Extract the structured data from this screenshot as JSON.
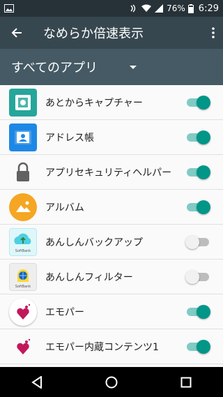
{
  "status_bar": {
    "battery": "76%",
    "time": "6:29"
  },
  "toolbar": {
    "title": "なめらか倍速表示"
  },
  "filter": {
    "label": "すべてのアプリ"
  },
  "apps": [
    {
      "name": "あとからキャプチャー",
      "enabled": true,
      "icon": "capture-icon"
    },
    {
      "name": "アドレス帳",
      "enabled": true,
      "icon": "address-book-icon"
    },
    {
      "name": "アプリセキュリティヘルパー",
      "enabled": true,
      "icon": "lock-icon"
    },
    {
      "name": "アルバム",
      "enabled": true,
      "icon": "album-icon"
    },
    {
      "name": "あんしんバックアップ",
      "enabled": false,
      "icon": "backup-icon",
      "brand": "SoftBank"
    },
    {
      "name": "あんしんフィルター",
      "enabled": false,
      "icon": "filter-icon",
      "brand": "SoftBank"
    },
    {
      "name": "エモパー",
      "enabled": true,
      "icon": "emopa-icon"
    },
    {
      "name": "エモパー内蔵コンテンツ1",
      "enabled": true,
      "icon": "emopa-content-icon"
    }
  ],
  "colors": {
    "status_bar": "#263238",
    "toolbar": "#37474f",
    "filter_bar": "#455a64",
    "switch_on": "#009688",
    "switch_on_track": "#80cbc4"
  }
}
